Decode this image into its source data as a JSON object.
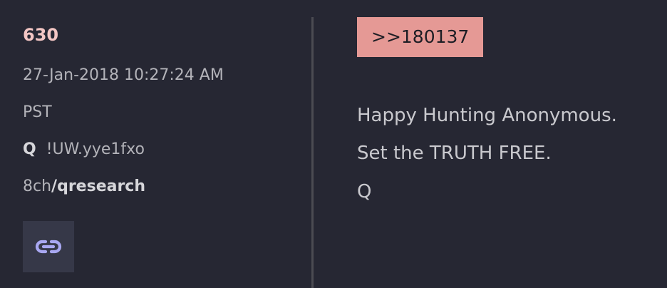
{
  "post": {
    "number": "630",
    "date": "27-Jan-2018 10:27:24 AM",
    "timezone": "PST",
    "trip_name": "Q",
    "trip_code": "!UW.yye1fxo",
    "board_site": "8ch",
    "board_name": "/qresearch",
    "link_icon": "link-chain-icon"
  },
  "message": {
    "reply_ref": ">>180137",
    "lines": [
      "Happy Hunting Anonymous.",
      "Set the TRUTH FREE.",
      "Q"
    ]
  },
  "colors": {
    "background": "#262733",
    "post_number": "#f3c6c4",
    "reply_badge": "#e59995",
    "link_icon": "#a9a8f2"
  }
}
